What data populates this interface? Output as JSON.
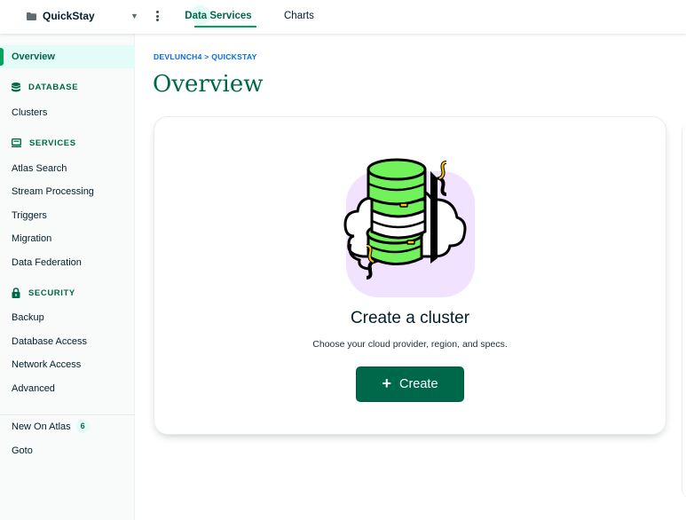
{
  "topbar": {
    "project_name": "QuickStay",
    "tabs": [
      {
        "label": "Data Services",
        "active": true
      },
      {
        "label": "Charts",
        "active": false
      }
    ]
  },
  "sidebar": {
    "overview": "Overview",
    "database_header": "DATABASE",
    "clusters": "Clusters",
    "services_header": "SERVICES",
    "services": [
      "Atlas Search",
      "Stream Processing",
      "Triggers",
      "Migration",
      "Data Federation"
    ],
    "security_header": "SECURITY",
    "security": [
      "Backup",
      "Database Access",
      "Network Access",
      "Advanced"
    ],
    "new_on_atlas": "New On Atlas",
    "new_on_atlas_count": "6",
    "goto": "Goto"
  },
  "main": {
    "breadcrumb": "DEVLUNCH4 > QUICKSTAY",
    "title": "Overview",
    "card": {
      "heading": "Create a cluster",
      "description": "Choose your cloud provider, region, and specs.",
      "button_label": "Create"
    }
  },
  "colors": {
    "brand_green": "#00684a",
    "accent_green": "#00a35c",
    "link_blue": "#016bf8",
    "illustration_green": "#71f15a",
    "illustration_lavender": "#f1e2ff"
  }
}
